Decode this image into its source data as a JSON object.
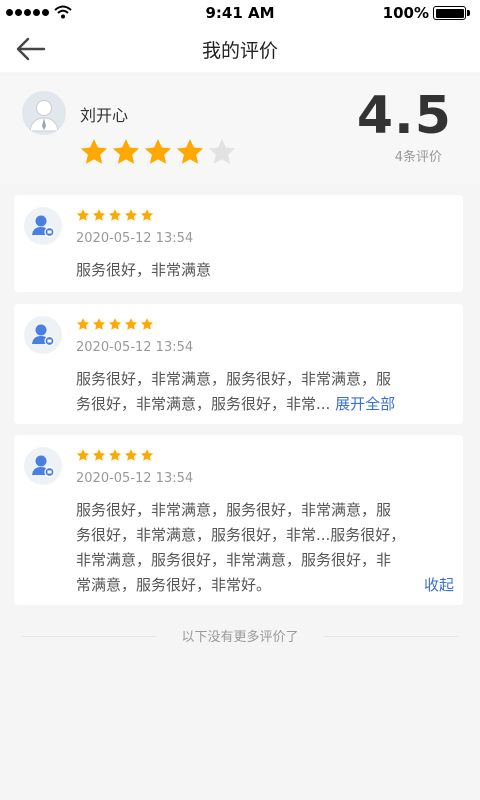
{
  "status_bar": {
    "time": "9:41 AM",
    "battery": "100%",
    "signal_icon": "signal-dots-icon",
    "wifi_icon": "wifi-icon"
  },
  "nav": {
    "title": "我的评价",
    "back_icon": "arrow-left-icon"
  },
  "summary": {
    "user_name": "刘开心",
    "stars_filled": 4,
    "stars_total": 5,
    "score": "4.5",
    "count_label": "4条评价"
  },
  "reviews": [
    {
      "stars": 5,
      "date": "2020-05-12 13:54",
      "lines": [
        "服务很好，非常满意"
      ]
    },
    {
      "stars": 5,
      "date": "2020-05-12 13:54",
      "lines": [
        "服务很好，非常满意，服务很好，非常满意，服",
        "务很好，非常满意，服务很好，非常..."
      ],
      "action": "展开全部"
    },
    {
      "stars": 5,
      "date": "2020-05-12 13:54",
      "lines": [
        "服务很好，非常满意，服务很好，非常满意，服",
        "务很好，非常满意，服务很好，非常...服务很好，",
        "非常满意，服务很好，非常满意，服务很好，非",
        "常满意，服务很好，非常好。"
      ],
      "action": "收起"
    }
  ],
  "footer": {
    "text": "以下没有更多评价了"
  },
  "colors": {
    "star_filled": "#ffa800",
    "star_empty": "#e2e2e2",
    "link": "#3a6fd8",
    "avatar_accent": "#4a7fe0"
  }
}
